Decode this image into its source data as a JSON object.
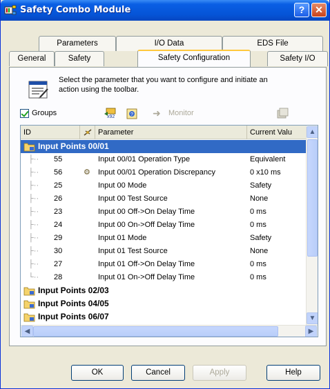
{
  "window": {
    "title": "Safety Combo Module",
    "help_glyph": "?",
    "close_glyph": "✕"
  },
  "tabs_back": [
    "Parameters",
    "I/O Data",
    "EDS File"
  ],
  "tabs_front": [
    "General",
    "Safety",
    "Safety Configuration",
    "Safety I/O"
  ],
  "active_tab": "Safety Configuration",
  "info": {
    "text": "Select the parameter that you want to configure and initiate an action using the toolbar."
  },
  "toolbar": {
    "groups_label": "Groups",
    "groups_checked": true,
    "monitor_label": "Monitor"
  },
  "grid": {
    "columns": [
      "ID",
      "Parameter",
      "Current Valu"
    ],
    "rows": [
      {
        "type": "group",
        "label": "Input Points 00/01",
        "selected": true
      },
      {
        "type": "param",
        "id": "55",
        "name": "Input 00/01 Operation Type",
        "value": "Equivalent",
        "has_icon": false
      },
      {
        "type": "param",
        "id": "56",
        "name": "Input 00/01 Operation Discrepancy",
        "value": "0 x10 ms",
        "has_icon": true
      },
      {
        "type": "param",
        "id": "25",
        "name": "Input 00 Mode",
        "value": "Safety",
        "has_icon": false
      },
      {
        "type": "param",
        "id": "26",
        "name": "Input 00 Test Source",
        "value": "None",
        "has_icon": false
      },
      {
        "type": "param",
        "id": "23",
        "name": "Input 00 Off->On Delay Time",
        "value": "0 ms",
        "has_icon": false
      },
      {
        "type": "param",
        "id": "24",
        "name": "Input 00 On->Off Delay Time",
        "value": "0 ms",
        "has_icon": false
      },
      {
        "type": "param",
        "id": "29",
        "name": "Input 01 Mode",
        "value": "Safety",
        "has_icon": false
      },
      {
        "type": "param",
        "id": "30",
        "name": "Input 01 Test Source",
        "value": "None",
        "has_icon": false
      },
      {
        "type": "param",
        "id": "27",
        "name": "Input 01 Off->On Delay Time",
        "value": "0 ms",
        "has_icon": false
      },
      {
        "type": "param",
        "id": "28",
        "name": "Input 01 On->Off Delay Time",
        "value": "0 ms",
        "has_icon": false
      },
      {
        "type": "group",
        "label": "Input Points 02/03",
        "selected": false
      },
      {
        "type": "group",
        "label": "Input Points 04/05",
        "selected": false
      },
      {
        "type": "group",
        "label": "Input Points 06/07",
        "selected": false
      }
    ]
  },
  "buttons": {
    "ok": "OK",
    "cancel": "Cancel",
    "apply": "Apply",
    "help": "Help"
  },
  "colors": {
    "titlebar": "#0554d7",
    "selection": "#316ac5",
    "active_tab_accent": "#ffc83c",
    "dialog_bg": "#ece9d8"
  }
}
